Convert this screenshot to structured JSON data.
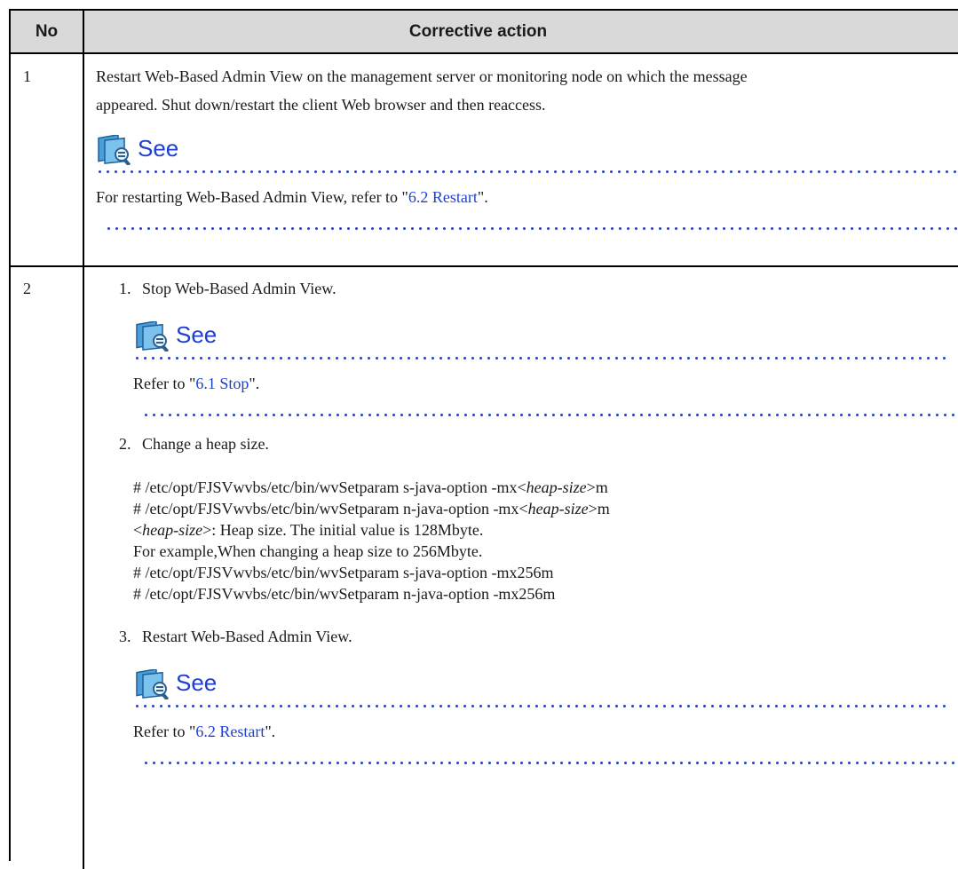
{
  "header": {
    "col_no": "No",
    "col_action": "Corrective action"
  },
  "row1": {
    "no": "1",
    "line1": "Restart Web-Based Admin View on the management server or monitoring node on which the message",
    "line2": "appeared. Shut down/restart the client Web browser and then reaccess.",
    "see_label": "See",
    "ref_prefix": "For restarting Web-Based Admin View, refer to \"",
    "ref_link": "6.2 Restart",
    "ref_suffix": "\"."
  },
  "row2": {
    "no": "2",
    "steps": [
      {
        "num": "1.",
        "text": "Stop Web-Based Admin View.",
        "see_label": "See",
        "ref_prefix": "Refer to \"",
        "ref_link": "6.1 Stop",
        "ref_suffix": "\"."
      },
      {
        "num": "2.",
        "text": "Change a heap size.",
        "cmd1_prefix": "# /etc/opt/FJSVwvbs/etc/bin/wvSetparam s-java-option -mx<",
        "cmd1_var": "heap-size",
        "cmd1_suffix": ">m",
        "cmd2_prefix": "# /etc/opt/FJSVwvbs/etc/bin/wvSetparam n-java-option -mx<",
        "cmd2_var": "heap-size",
        "cmd2_suffix": ">m",
        "note_prefix": "<",
        "note_var": "heap-size",
        "note_suffix": ">: Heap size. The initial value is 128Mbyte.",
        "example": "For example,When changing a heap size to 256Mbyte.",
        "cmd3": "# /etc/opt/FJSVwvbs/etc/bin/wvSetparam s-java-option -mx256m",
        "cmd4": "# /etc/opt/FJSVwvbs/etc/bin/wvSetparam n-java-option -mx256m"
      },
      {
        "num": "3.",
        "text": "Restart Web-Based Admin View.",
        "see_label": "See",
        "ref_prefix": "Refer to \"",
        "ref_link": "6.2 Restart",
        "ref_suffix": "\"."
      }
    ]
  },
  "colors": {
    "link": "#1e3fd6",
    "header_bg": "#d9d9d9",
    "dots": "#2a44cf"
  },
  "icons": [
    "see-book-icon"
  ]
}
